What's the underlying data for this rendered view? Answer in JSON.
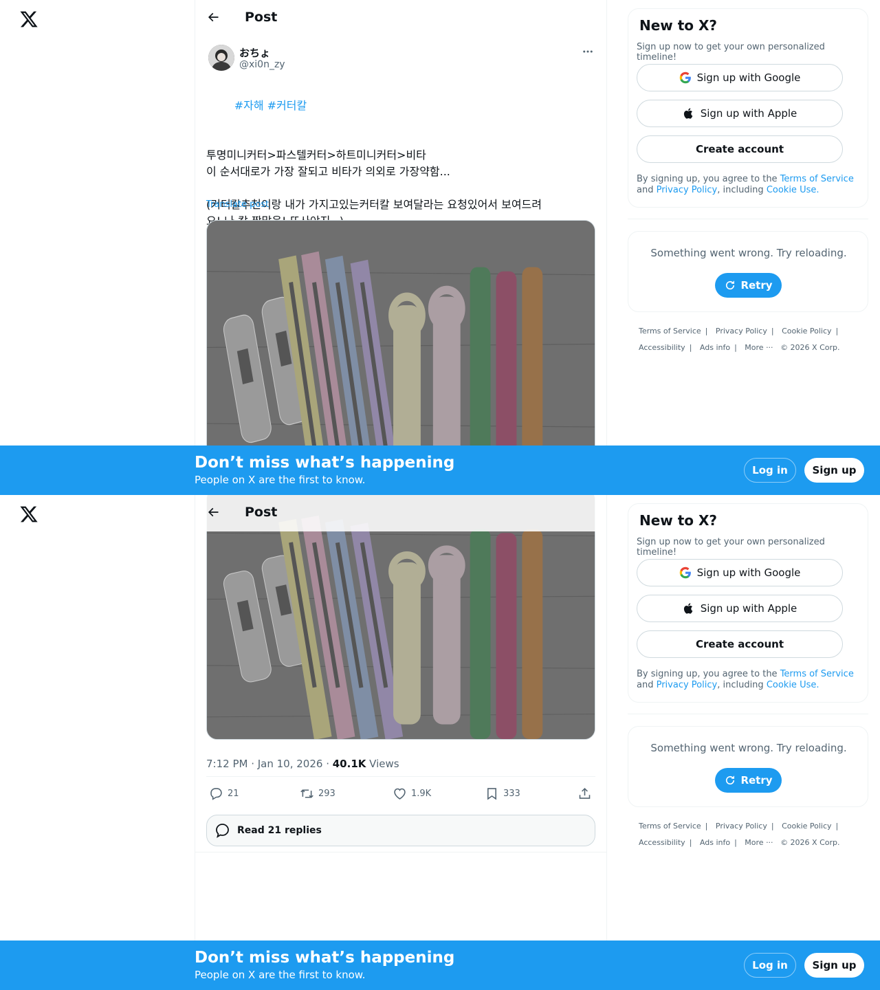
{
  "header": {
    "title": "Post"
  },
  "author": {
    "name": "おちょ",
    "handle": "@xi0n_zy"
  },
  "post": {
    "hashtags": [
      "#자해",
      "#커터칼"
    ],
    "lines": [
      "투명미니커터>파스텔커터>하트미니커터>비타",
      "이 순서대로가 가장 잘되고 비타가 의외로 가장약함...",
      "",
      "(커터칼추천이랑 내가 가지고있는커터칼 보여달라는 요청있어서 보여드려",
      "요! 나 칼 짱많음! 또사야지~)"
    ],
    "translate_label": "Translate post",
    "timestamp": "7:12 PM · Jan 10, 2026 · ",
    "views_count": "40.1K",
    "views_label": " Views"
  },
  "actions": {
    "replies": "21",
    "reposts": "293",
    "likes": "1.9K",
    "bookmarks": "333"
  },
  "read_replies_label": "Read 21 replies",
  "sidebar": {
    "newx_title": "New to X?",
    "newx_subtitle": "Sign up now to get your own personalized timeline!",
    "google_label": "Sign up with Google",
    "apple_label": "Sign up with Apple",
    "create_label": "Create account",
    "legal_prefix": "By signing up, you agree to the ",
    "legal_terms": "Terms of Service",
    "legal_and": " and ",
    "legal_privacy": "Privacy Policy",
    "legal_including": ", including ",
    "legal_cookie": "Cookie Use.",
    "error_text": "Something went wrong. Try reloading.",
    "retry_label": "Retry"
  },
  "footer": {
    "terms": "Terms of Service",
    "privacy": "Privacy Policy",
    "cookie": "Cookie Policy",
    "accessibility": "Accessibility",
    "ads": "Ads info",
    "more": "More ···",
    "copyright": "© 2026 X Corp."
  },
  "banner": {
    "title": "Don’t miss what’s happening",
    "subtitle": "People on X are the first to know.",
    "login_label": "Log in",
    "signup_label": "Sign up"
  },
  "colors": {
    "accent": "#1d9bf0",
    "text": "#0f1419",
    "muted": "#536471"
  },
  "icons": [
    "x-logo-icon",
    "back-arrow-icon",
    "more-icon",
    "reply-icon",
    "repost-icon",
    "like-icon",
    "bookmark-icon",
    "share-icon",
    "speech-bubble-icon",
    "google-icon",
    "apple-icon",
    "retry-icon"
  ]
}
